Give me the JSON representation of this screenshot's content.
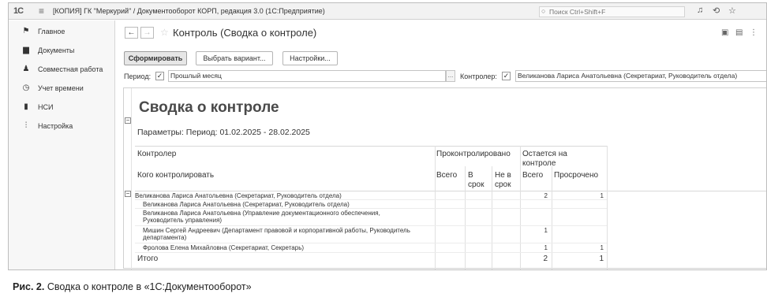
{
  "titlebar": {
    "logo": "1С",
    "title": "[КОПИЯ] ГК \"Меркурий\" / Документооборот КОРП, редакция 3.0  (1С:Предприятие)",
    "search_placeholder": "Поиск Ctrl+Shift+F",
    "icons": [
      "bell-icon",
      "history-icon",
      "star-icon"
    ]
  },
  "sidebar": {
    "items": [
      {
        "label": "Главное",
        "icon": "flag-icon"
      },
      {
        "label": "Документы",
        "icon": "documents-icon"
      },
      {
        "label": "Совместная работа",
        "icon": "people-icon"
      },
      {
        "label": "Учет времени",
        "icon": "clock-icon"
      },
      {
        "label": "НСИ",
        "icon": "book-icon"
      },
      {
        "label": "Настройка",
        "icon": "settings-icon"
      }
    ]
  },
  "form": {
    "title": "Контроль (Сводка о контроле)",
    "buttons": {
      "generate": "Сформировать",
      "choose_variant": "Выбрать вариант...",
      "settings": "Настройки..."
    },
    "period_label": "Период:",
    "period_checked": true,
    "period_value": "Прошлый месяц",
    "period_dots": "...",
    "controller_label": "Контролер:",
    "controller_checked": true,
    "controller_value": "Великанова Лариса Анатольевна (Секретариат, Руководитель отдела)"
  },
  "report": {
    "title": "Сводка о контроле",
    "params": "Параметры:  Период: 01.02.2025 - 28.02.2025",
    "headers": {
      "controller": "Контролер",
      "whom": "Кого контролировать",
      "controlled": "Проконтролировано",
      "remaining": "Остается на контроле",
      "total": "Всего",
      "on_time": "В срок",
      "late": "Не в срок",
      "remaining_total": "Всего",
      "overdue": "Просрочено"
    },
    "rows": [
      {
        "text": "Великанова Лариса Анатольевна (Секретариат, Руководитель отдела)",
        "remaining_total": "2",
        "overdue": "1"
      },
      {
        "text": "Великанова Лариса Анатольевна (Секретариат, Руководитель отдела)",
        "remaining_total": "",
        "overdue": ""
      },
      {
        "text": "Великанова Лариса Анатольевна (Управление документационного обеспечения, Руководитель управления)",
        "remaining_total": "",
        "overdue": ""
      },
      {
        "text": "Мишин Сергей Андреевич (Департамент правовой и корпоративной работы, Руководитель департамента)",
        "remaining_total": "1",
        "overdue": ""
      },
      {
        "text": "Фролова Елена Михайловна (Секретариат, Секретарь)",
        "remaining_total": "1",
        "overdue": "1"
      }
    ],
    "total_label": "Итого",
    "total_remaining": "2",
    "total_overdue": "1"
  },
  "caption": {
    "bold": "Рис. 2.",
    "text": " Сводка о контроле в «1С:Документооборот»"
  }
}
